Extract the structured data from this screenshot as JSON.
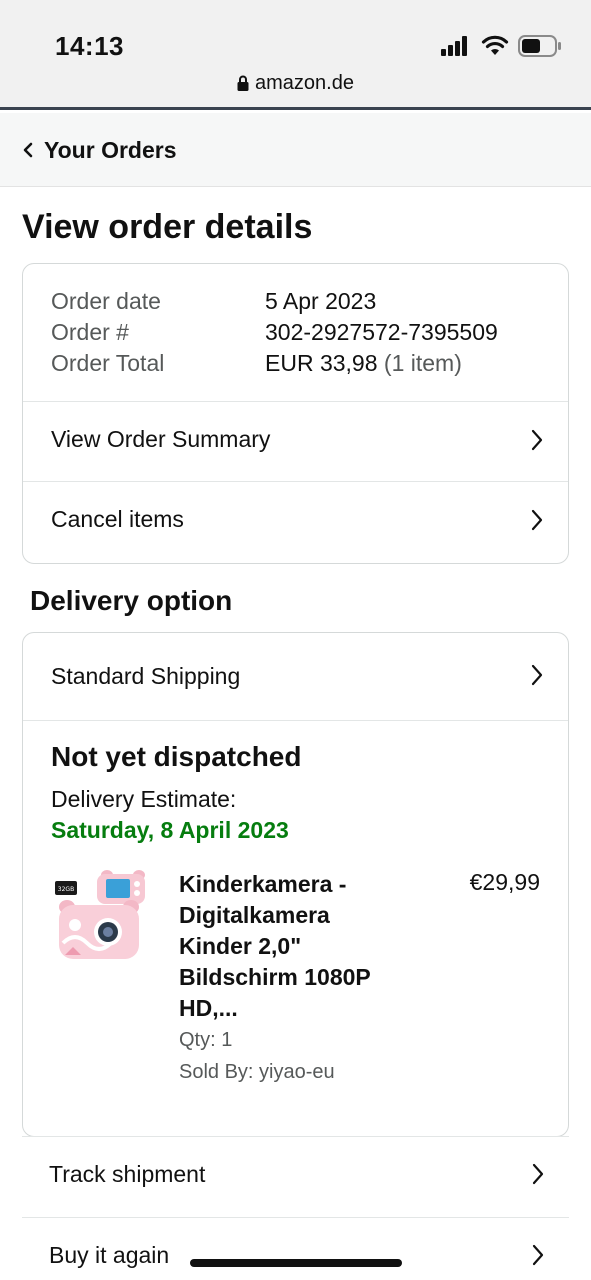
{
  "status_bar": {
    "time": "14:13",
    "url": "amazon.de"
  },
  "nav": {
    "back_label": "Your Orders"
  },
  "page_title": "View order details",
  "order": {
    "date_label": "Order date",
    "date_value": "5 Apr 2023",
    "number_label": "Order #",
    "number_value": "302-2927572-7395509",
    "total_label": "Order Total",
    "total_value": "EUR 33,98",
    "total_items": "(1 item)"
  },
  "order_links": {
    "summary": "View Order Summary",
    "cancel": "Cancel items"
  },
  "delivery": {
    "section_title": "Delivery option",
    "option": "Standard Shipping",
    "status": "Not yet dispatched",
    "estimate_label": "Delivery Estimate:",
    "estimate_date": "Saturday, 8 April 2023"
  },
  "product": {
    "title": "Kinderkamera - Digitalkamera Kinder 2,0\" Bildschirm 1080P HD,...",
    "price": "€29,99",
    "qty": "Qty: 1",
    "seller": "Sold By: yiyao-eu",
    "sd_card_label": "32GB"
  },
  "actions": {
    "track": "Track shipment",
    "buy_again": "Buy it again"
  },
  "colors": {
    "estimate_green": "#067d0f",
    "border": "#d5d9d9"
  }
}
